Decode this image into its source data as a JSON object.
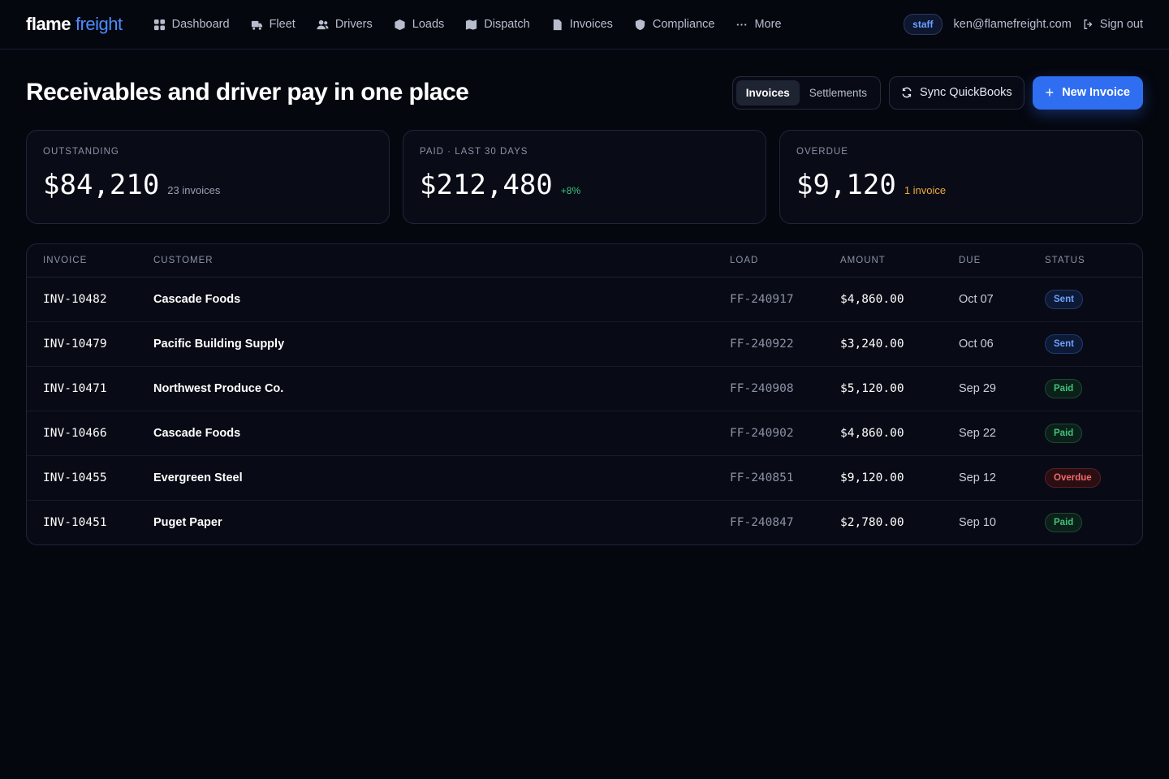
{
  "brand": {
    "part1": "flame",
    "part2": "freight"
  },
  "nav": [
    {
      "label": "Dashboard",
      "icon": "dashboard-icon"
    },
    {
      "label": "Fleet",
      "icon": "truck-icon"
    },
    {
      "label": "Drivers",
      "icon": "users-icon"
    },
    {
      "label": "Loads",
      "icon": "box-icon"
    },
    {
      "label": "Dispatch",
      "icon": "map-icon"
    },
    {
      "label": "Invoices",
      "icon": "document-icon"
    },
    {
      "label": "Compliance",
      "icon": "shield-icon"
    },
    {
      "label": "More",
      "icon": "ellipsis-icon"
    }
  ],
  "user": {
    "role": "staff",
    "email": "ken@flamefreight.com",
    "signout": "Sign out"
  },
  "header": {
    "title": "Receivables and driver pay in one place",
    "tabs": [
      "Invoices",
      "Settlements"
    ],
    "sync_label": "Sync QuickBooks",
    "new_label": "New Invoice"
  },
  "stats": [
    {
      "label": "OUTSTANDING",
      "value": "$84,210",
      "sub": "23 invoices"
    },
    {
      "label": "PAID · LAST 30 DAYS",
      "value": "$212,480",
      "sub": "+8%"
    },
    {
      "label": "OVERDUE",
      "value": "$9,120",
      "sub": "1 invoice"
    }
  ],
  "table": {
    "headers": [
      "INVOICE",
      "CUSTOMER",
      "LOAD",
      "AMOUNT",
      "DUE",
      "STATUS"
    ],
    "rows": [
      {
        "invoice": "INV-10482",
        "customer": "Cascade Foods",
        "load": "FF-240917",
        "amount": "$4,860.00",
        "due": "Oct 07",
        "status": "Sent"
      },
      {
        "invoice": "INV-10479",
        "customer": "Pacific Building Supply",
        "load": "FF-240922",
        "amount": "$3,240.00",
        "due": "Oct 06",
        "status": "Sent"
      },
      {
        "invoice": "INV-10471",
        "customer": "Northwest Produce Co.",
        "load": "FF-240908",
        "amount": "$5,120.00",
        "due": "Sep 29",
        "status": "Paid"
      },
      {
        "invoice": "INV-10466",
        "customer": "Cascade Foods",
        "load": "FF-240902",
        "amount": "$4,860.00",
        "due": "Sep 22",
        "status": "Paid"
      },
      {
        "invoice": "INV-10455",
        "customer": "Evergreen Steel",
        "load": "FF-240851",
        "amount": "$9,120.00",
        "due": "Sep 12",
        "status": "Overdue"
      },
      {
        "invoice": "INV-10451",
        "customer": "Puget Paper",
        "load": "FF-240847",
        "amount": "$2,780.00",
        "due": "Sep 10",
        "status": "Paid"
      }
    ]
  },
  "colors": {
    "background": "#05070f",
    "accent": "#2f6ef0",
    "paid": "#3fc27b",
    "sent": "#6ea0ff",
    "overdue": "#f06b6b",
    "warning": "#f2a93b"
  }
}
